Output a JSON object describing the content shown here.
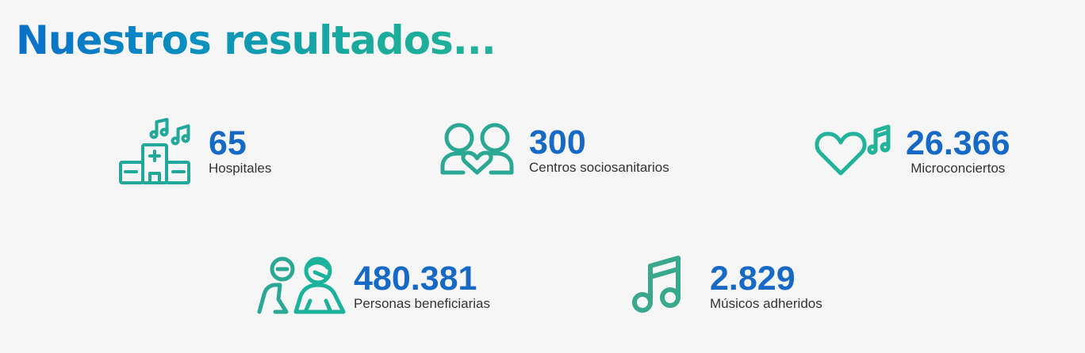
{
  "title": "Nuestros resultados...",
  "colors": {
    "accent_blue": "#1769c6",
    "accent_teal": "#22a89a",
    "background": "#f6f6f6"
  },
  "stats": [
    {
      "icon": "hospital-music-icon",
      "value": "65",
      "label": "Hospitales"
    },
    {
      "icon": "people-heart-icon",
      "value": "300",
      "label": "Centros sociosanitarios"
    },
    {
      "icon": "heart-music-icon",
      "value": "26.366",
      "label": "Microconciertos"
    },
    {
      "icon": "persons-icon",
      "value": "480.381",
      "label": "Personas beneficiarias"
    },
    {
      "icon": "music-note-icon",
      "value": "2.829",
      "label": "Músicos adheridos"
    }
  ]
}
